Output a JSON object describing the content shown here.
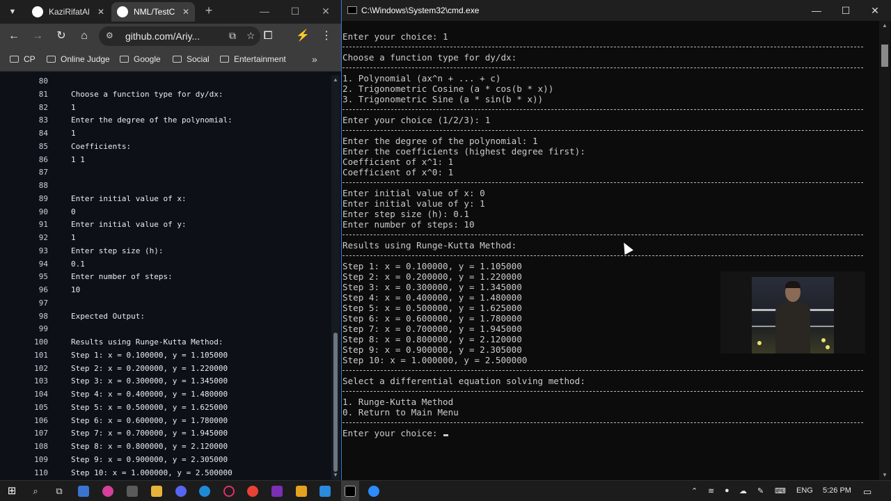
{
  "browser": {
    "tabs": [
      {
        "label": "KaziRifatAl"
      },
      {
        "label": "NML/TestC"
      }
    ],
    "url": "github.com/Ariy...",
    "bookmarks": [
      "CP",
      "Online Judge",
      "Google",
      "Social",
      "Entertainment"
    ],
    "code_lines": [
      {
        "n": "80",
        "t": ""
      },
      {
        "n": "81",
        "t": "Choose a function type for dy/dx:"
      },
      {
        "n": "82",
        "t": "1"
      },
      {
        "n": "83",
        "t": "Enter the degree of the polynomial:"
      },
      {
        "n": "84",
        "t": "1"
      },
      {
        "n": "85",
        "t": "Coefficients:"
      },
      {
        "n": "86",
        "t": "1 1"
      },
      {
        "n": "87",
        "t": ""
      },
      {
        "n": "88",
        "t": ""
      },
      {
        "n": "89",
        "t": "Enter initial value of x:"
      },
      {
        "n": "90",
        "t": "0"
      },
      {
        "n": "91",
        "t": "Enter initial value of y:"
      },
      {
        "n": "92",
        "t": "1"
      },
      {
        "n": "93",
        "t": "Enter step size (h):"
      },
      {
        "n": "94",
        "t": "0.1"
      },
      {
        "n": "95",
        "t": "Enter number of steps:"
      },
      {
        "n": "96",
        "t": "10"
      },
      {
        "n": "97",
        "t": ""
      },
      {
        "n": "98",
        "t": "Expected Output:"
      },
      {
        "n": "99",
        "t": ""
      },
      {
        "n": "100",
        "t": "Results using Runge-Kutta Method:"
      },
      {
        "n": "101",
        "t": "Step 1: x = 0.100000, y = 1.105000"
      },
      {
        "n": "102",
        "t": "Step 2: x = 0.200000, y = 1.220000"
      },
      {
        "n": "103",
        "t": "Step 3: x = 0.300000, y = 1.345000"
      },
      {
        "n": "104",
        "t": "Step 4: x = 0.400000, y = 1.480000"
      },
      {
        "n": "105",
        "t": "Step 5: x = 0.500000, y = 1.625000"
      },
      {
        "n": "106",
        "t": "Step 6: x = 0.600000, y = 1.780000"
      },
      {
        "n": "107",
        "t": "Step 7: x = 0.700000, y = 1.945000"
      },
      {
        "n": "108",
        "t": "Step 8: x = 0.800000, y = 2.120000"
      },
      {
        "n": "109",
        "t": "Step 9: x = 0.900000, y = 2.305000"
      },
      {
        "n": "110",
        "t": "Step 10: x = 1.000000, y = 2.500000"
      }
    ]
  },
  "cmd": {
    "title": "C:\\Windows\\System32\\cmd.exe",
    "lines": [
      {
        "kind": "text",
        "t": "Enter your choice: 1"
      },
      {
        "kind": "dash"
      },
      {
        "kind": "text",
        "t": "Choose a function type for dy/dx:"
      },
      {
        "kind": "dash"
      },
      {
        "kind": "text",
        "t": "1. Polynomial (ax^n + ... + c)"
      },
      {
        "kind": "text",
        "t": "2. Trigonometric Cosine (a * cos(b * x))"
      },
      {
        "kind": "text",
        "t": "3. Trigonometric Sine (a * sin(b * x))"
      },
      {
        "kind": "dash"
      },
      {
        "kind": "text",
        "t": "Enter your choice (1/2/3): 1"
      },
      {
        "kind": "dash"
      },
      {
        "kind": "text",
        "t": "Enter the degree of the polynomial: 1"
      },
      {
        "kind": "text",
        "t": "Enter the coefficients (highest degree first):"
      },
      {
        "kind": "text",
        "t": "Coefficient of x^1: 1"
      },
      {
        "kind": "text",
        "t": "Coefficient of x^0: 1"
      },
      {
        "kind": "dash"
      },
      {
        "kind": "text",
        "t": "Enter initial value of x: 0"
      },
      {
        "kind": "text",
        "t": "Enter initial value of y: 1"
      },
      {
        "kind": "text",
        "t": "Enter step size (h): 0.1"
      },
      {
        "kind": "text",
        "t": "Enter number of steps: 10"
      },
      {
        "kind": "dash"
      },
      {
        "kind": "text",
        "t": "Results using Runge-Kutta Method:"
      },
      {
        "kind": "dash"
      },
      {
        "kind": "text",
        "t": "Step 1: x = 0.100000, y = 1.105000"
      },
      {
        "kind": "text",
        "t": "Step 2: x = 0.200000, y = 1.220000"
      },
      {
        "kind": "text",
        "t": "Step 3: x = 0.300000, y = 1.345000"
      },
      {
        "kind": "text",
        "t": "Step 4: x = 0.400000, y = 1.480000"
      },
      {
        "kind": "text",
        "t": "Step 5: x = 0.500000, y = 1.625000"
      },
      {
        "kind": "text",
        "t": "Step 6: x = 0.600000, y = 1.780000"
      },
      {
        "kind": "text",
        "t": "Step 7: x = 0.700000, y = 1.945000"
      },
      {
        "kind": "text",
        "t": "Step 8: x = 0.800000, y = 2.120000"
      },
      {
        "kind": "text",
        "t": "Step 9: x = 0.900000, y = 2.305000"
      },
      {
        "kind": "text",
        "t": "Step 10: x = 1.000000, y = 2.500000"
      },
      {
        "kind": "dash"
      },
      {
        "kind": "text",
        "t": "Select a differential equation solving method:"
      },
      {
        "kind": "dash"
      },
      {
        "kind": "text",
        "t": "1. Runge-Kutta Method"
      },
      {
        "kind": "text",
        "t": "0. Return to Main Menu"
      },
      {
        "kind": "dash"
      },
      {
        "kind": "prompt",
        "t": "Enter your choice: "
      }
    ]
  },
  "taskbar": {
    "language": "ENG",
    "time": "5:26 PM"
  },
  "colors": {
    "browser_bg": "#0d1117",
    "console_bg": "#0c0c0c",
    "console_text": "#cccccc",
    "cmd_border": "#3b78d8"
  }
}
